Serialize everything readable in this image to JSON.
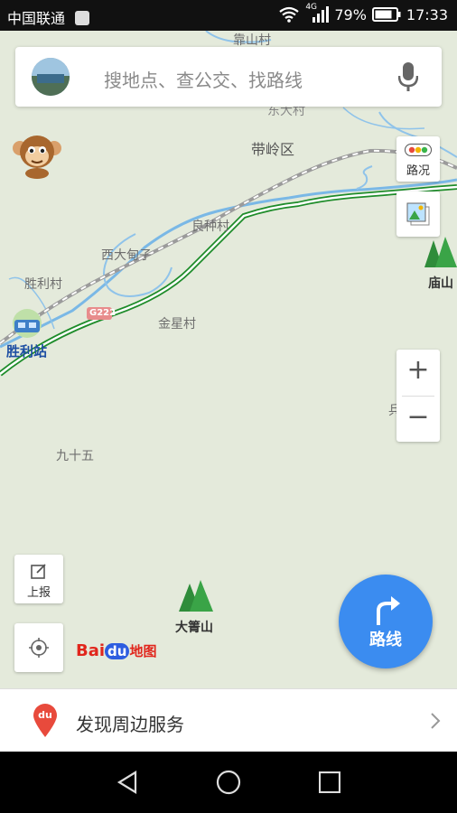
{
  "status_bar": {
    "carrier": "中国联通",
    "network": "4G",
    "battery": "79%",
    "time": "17:33"
  },
  "search": {
    "placeholder": "搜地点、查公交、找路线"
  },
  "map": {
    "labels": {
      "kaoshan": "靠山村",
      "dongda": "东大村",
      "dailing": "带岭区",
      "liangzhong": "良种村",
      "xidadianzi": "西大甸子",
      "shengli": "胜利村",
      "jinxing": "金星村",
      "jiushiwu": "九十五",
      "bing": "兵",
      "miaoshan": "庙山",
      "dajianshan": "大箐山",
      "station": "胜利站",
      "road": "G222"
    }
  },
  "controls": {
    "traffic_label": "路况",
    "report_label": "上报",
    "zoom_in": "+",
    "zoom_out": "−",
    "route_label": "路线"
  },
  "logo": {
    "bai": "Bai",
    "du": "du",
    "map": "地图"
  },
  "discover": {
    "text": "发现周边服务",
    "badge": "du"
  },
  "colors": {
    "route_blue": "#3b8cf0",
    "road_green": "#1e8c2a",
    "water_blue": "#7ab8e6",
    "map_bg": "#e4eadb"
  }
}
